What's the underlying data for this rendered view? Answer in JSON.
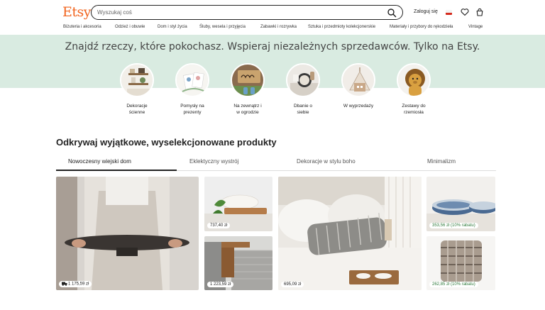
{
  "header": {
    "logo": "Etsy",
    "search_placeholder": "Wyszukaj coś",
    "signin": "Zaloguj się"
  },
  "nav": [
    "Biżuteria i akcesoria",
    "Odzież i obuwie",
    "Dom i styl życia",
    "Śluby, wesela i przyjęcia",
    "Zabawki i rozrywka",
    "Sztuka i przedmioty kolekcjonerskie",
    "Materiały i przybory do rękodzieła",
    "Vintage"
  ],
  "hero": {
    "text": "Znajdź rzeczy, które pokochasz. Wspieraj niezależnych sprzedawców. Tylko na Etsy."
  },
  "categories": [
    {
      "line1": "Dekoracje",
      "line2": "ścienne"
    },
    {
      "line1": "Pomysły na",
      "line2": "prezenty"
    },
    {
      "line1": "Na zewnątrz i",
      "line2": "w ogrodzie"
    },
    {
      "line1": "Dbanie o",
      "line2": "siebie"
    },
    {
      "line1": "W wyprzedaży",
      "line2": ""
    },
    {
      "line1": "Zestawy do",
      "line2": "rzemiosła"
    }
  ],
  "section": {
    "title": "Odkrywaj wyjątkowe, wyselekcjonowane produkty",
    "tabs": [
      "Nowoczesny wiejski dom",
      "Eklektyczny wystrój",
      "Dekoracje w stylu boho",
      "Minimalizm"
    ]
  },
  "products": [
    {
      "price": "1 175,59 zł"
    },
    {
      "price": "737,40 zł"
    },
    {
      "price": "1 223,59 zł"
    },
    {
      "price": "695,09 zł"
    },
    {
      "price": "353,56 zł (10% rabatu)"
    },
    {
      "price": "262,85 zł (10% rabatu)"
    }
  ],
  "colors": {
    "brand": "#f1641e",
    "hero_bg": "#d9ebe1",
    "sale": "#2f7a3b"
  },
  "icons": [
    "search-icon",
    "poland-flag-icon",
    "heart-icon",
    "shopping-bag-icon",
    "delivery-truck-icon"
  ]
}
